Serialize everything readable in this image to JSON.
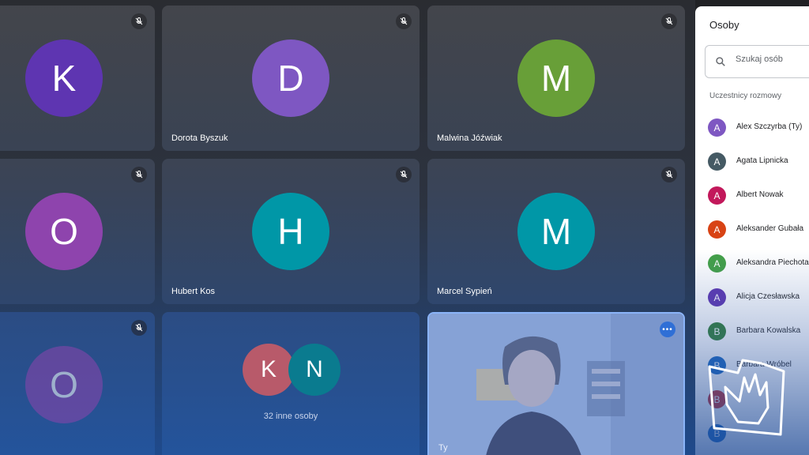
{
  "tiles": [
    {
      "initial": "K",
      "name": "",
      "color": "#5e35b1",
      "muted": true
    },
    {
      "initial": "D",
      "name": "Dorota Byszuk",
      "color": "#7e57c2",
      "muted": true
    },
    {
      "initial": "M",
      "name": "Malwina Jóźwiak",
      "color": "#689f38",
      "muted": true
    },
    {
      "initial": "O",
      "name": "",
      "color": "#8e44ad",
      "muted": true
    },
    {
      "initial": "H",
      "name": "Hubert Kos",
      "color": "#0097a7",
      "muted": true
    },
    {
      "initial": "M",
      "name": "Marcel Sypień",
      "color": "#0097a7",
      "muted": true
    },
    {
      "initial": "O",
      "name": "",
      "color": "#8e44ad",
      "muted": true
    }
  ],
  "others_tile": {
    "initials": [
      "K",
      "N"
    ],
    "colors": [
      "#b85a6a",
      "#0a7b8f"
    ],
    "label": "32 inne osoby"
  },
  "self_tile": {
    "name": "Ty",
    "more_icon": "more-horiz-icon"
  },
  "panel": {
    "title": "Osoby",
    "search_placeholder": "Szukaj osób",
    "section_label": "Uczestnicy rozmowy",
    "participants": [
      {
        "initial": "A",
        "name": "Alex Szczyrba (Ty)",
        "color": "#7e57c2"
      },
      {
        "initial": "A",
        "name": "Agata Lipnicka",
        "color": "#455a64"
      },
      {
        "initial": "A",
        "name": "Albert Nowak",
        "color": "#c2185b"
      },
      {
        "initial": "A",
        "name": "Aleksander Gubała",
        "color": "#d84315"
      },
      {
        "initial": "A",
        "name": "Aleksandra Piechota",
        "color": "#43a047"
      },
      {
        "initial": "A",
        "name": "Alicja Czesławska",
        "color": "#5e35b1"
      },
      {
        "initial": "B",
        "name": "Barbara Kowalska",
        "color": "#2e7d32"
      },
      {
        "initial": "B",
        "name": "Barbara Wróbel",
        "color": "#1565c0"
      },
      {
        "initial": "B",
        "name": "",
        "color": "#c62828"
      },
      {
        "initial": "B",
        "name": "",
        "color": "#1565c0"
      }
    ]
  }
}
